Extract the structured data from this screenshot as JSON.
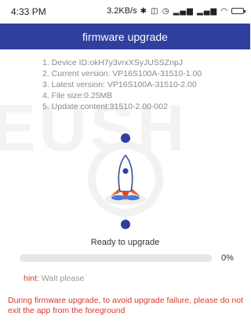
{
  "status_bar": {
    "time": "4:33 PM",
    "net_speed": "3.2KB/s",
    "icons": [
      "bluetooth-icon",
      "nfc-icon",
      "alarm-icon",
      "signal-icon",
      "signal-icon",
      "wifi-icon",
      "battery-icon"
    ]
  },
  "header": {
    "title": "firmware upgrade",
    "color": "#2f3f9e"
  },
  "watermark": {
    "text": "EUSH"
  },
  "info": [
    "1. Device ID:okH7y3vrxXSyJUSSZnpJ",
    "2. Current version: VP16S100A-31510-1.00",
    "3. Latest version: VP16S100A-31510-2.00",
    "4. File size:0.25MB",
    "5. Update content:31510-2.00-002"
  ],
  "illustration": {
    "icon": "rocket-icon"
  },
  "status": {
    "text": "Ready to upgrade"
  },
  "progress": {
    "value": 0,
    "label": "0%"
  },
  "hint": {
    "label": "hint:",
    "value": "Wait please"
  },
  "warning": {
    "text": "During firmware upgrade, to avoid upgrade failure, please do not exit the app from the foreground",
    "color": "#d43a2f"
  }
}
